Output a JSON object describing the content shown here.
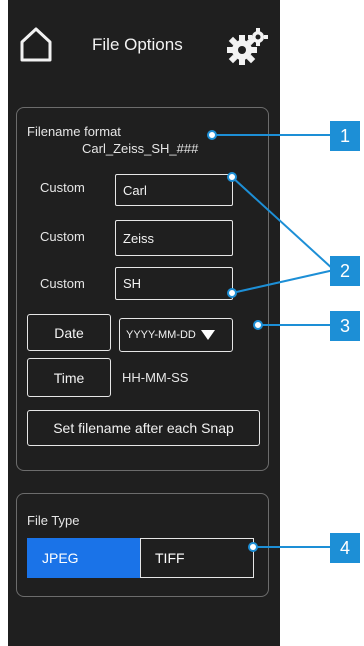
{
  "header": {
    "title": "File Options",
    "home_icon": "home-outline-icon",
    "settings_icon": "gears-icon"
  },
  "filename_format": {
    "heading": "Filename format",
    "preview": "Carl_Zeiss_SH_###",
    "custom_rows": [
      {
        "label": "Custom",
        "value": "Carl"
      },
      {
        "label": "Custom",
        "value": "Zeiss"
      },
      {
        "label": "Custom",
        "value": "SH"
      }
    ],
    "date_button": "Date",
    "date_format": "YYYY-MM-DD",
    "time_button": "Time",
    "time_format": "HH-MM-SS",
    "set_after_snap_button": "Set filename after each Snap"
  },
  "file_type": {
    "heading": "File Type",
    "options": [
      "JPEG",
      "TIFF"
    ],
    "selected": "JPEG"
  },
  "callouts": [
    "1",
    "2",
    "3",
    "4"
  ],
  "colors": {
    "panel_bg": "#1f1f1f",
    "accent_selected": "#1a73e8",
    "callout": "#1d8fd6"
  }
}
